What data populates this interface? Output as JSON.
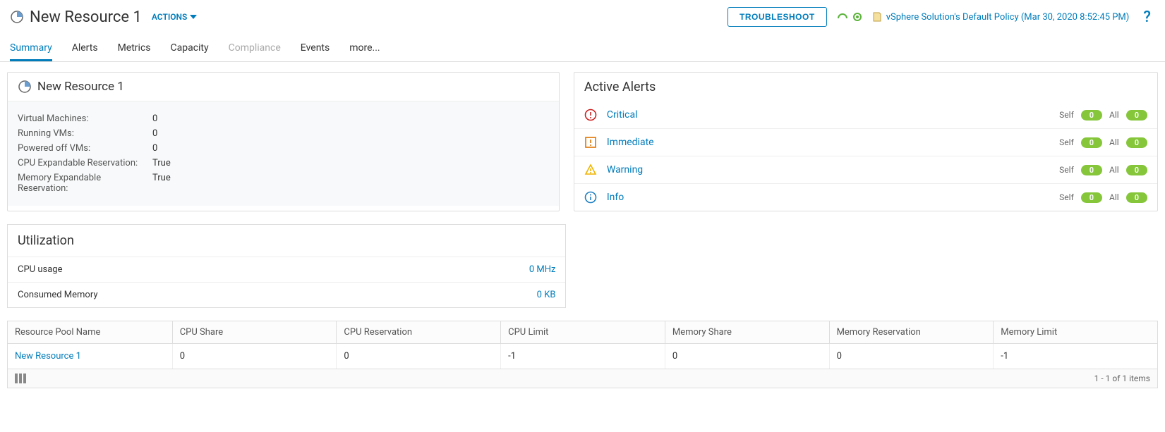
{
  "header": {
    "title": "New Resource 1",
    "actions_label": "ACTIONS",
    "troubleshoot_label": "TROUBLESHOOT",
    "policy_link": "vSphere Solution's Default Policy (Mar 30, 2020 8:52:45 PM)"
  },
  "tabs": [
    {
      "label": "Summary",
      "active": true
    },
    {
      "label": "Alerts"
    },
    {
      "label": "Metrics"
    },
    {
      "label": "Capacity"
    },
    {
      "label": "Compliance",
      "disabled": true
    },
    {
      "label": "Events"
    },
    {
      "label": "more..."
    }
  ],
  "resource_panel": {
    "title": "New Resource 1",
    "rows": [
      {
        "k": "Virtual Machines:",
        "v": "0"
      },
      {
        "k": "Running VMs:",
        "v": "0"
      },
      {
        "k": "Powered off VMs:",
        "v": "0"
      },
      {
        "k": "CPU Expandable Reservation:",
        "v": "True"
      },
      {
        "k": "Memory Expandable Reservation:",
        "v": "True"
      }
    ]
  },
  "alerts_panel": {
    "title": "Active Alerts",
    "self_label": "Self",
    "all_label": "All",
    "levels": [
      {
        "name": "Critical",
        "color": "#cc1f1f",
        "self": "0",
        "all": "0"
      },
      {
        "name": "Immediate",
        "color": "#e07400",
        "self": "0",
        "all": "0"
      },
      {
        "name": "Warning",
        "color": "#f0b400",
        "self": "0",
        "all": "0"
      },
      {
        "name": "Info",
        "color": "#1e7fc2",
        "self": "0",
        "all": "0"
      }
    ]
  },
  "utilization": {
    "title": "Utilization",
    "rows": [
      {
        "label": "CPU usage",
        "value": "0 MHz"
      },
      {
        "label": "Consumed Memory",
        "value": "0 KB"
      }
    ]
  },
  "grid": {
    "headers": [
      "Resource Pool Name",
      "CPU Share",
      "CPU Reservation",
      "CPU Limit",
      "Memory Share",
      "Memory Reservation",
      "Memory Limit"
    ],
    "row": [
      "New Resource 1",
      "0",
      "0",
      "-1",
      "0",
      "0",
      "-1"
    ],
    "footer": "1 - 1 of 1 items"
  }
}
